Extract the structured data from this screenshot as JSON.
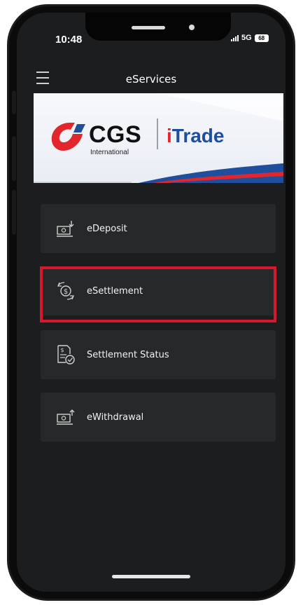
{
  "status_bar": {
    "time": "10:48",
    "network": "5G",
    "battery": "68"
  },
  "header": {
    "title": "eServices",
    "menu_icon": "hamburger-icon"
  },
  "banner": {
    "brand_main": "CGS",
    "brand_sub": "International",
    "product_i": "i",
    "product_name": "Trade",
    "colors": {
      "red": "#e3262b",
      "blue": "#1f4e9c"
    }
  },
  "menu": [
    {
      "label": "eDeposit",
      "icon": "deposit-icon"
    },
    {
      "label": "eSettlement",
      "icon": "settlement-icon",
      "highlighted": true
    },
    {
      "label": "Settlement Status",
      "icon": "settlement-status-icon"
    },
    {
      "label": "eWithdrawal",
      "icon": "withdrawal-icon"
    }
  ],
  "colors": {
    "highlight": "#d7172d",
    "background": "#1c1d1f",
    "item": "#272829"
  }
}
